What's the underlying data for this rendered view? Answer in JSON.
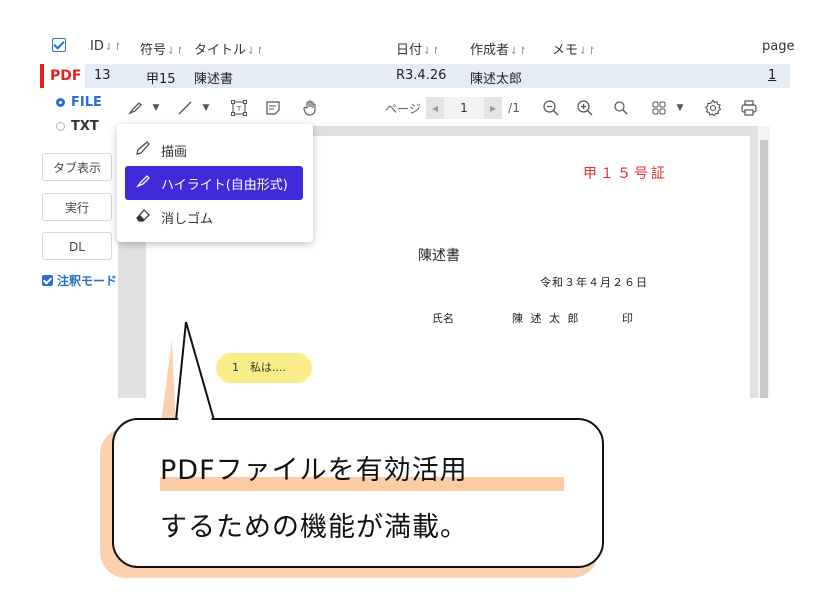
{
  "table": {
    "columns": [
      {
        "label": "ID"
      },
      {
        "label": "符号"
      },
      {
        "label": "タイトル"
      },
      {
        "label": "日付"
      },
      {
        "label": "作成者"
      },
      {
        "label": "メモ"
      },
      {
        "label": "page"
      }
    ],
    "sort_glyph": "⇃↾",
    "row": {
      "badge": "PDF",
      "id": "13",
      "code": "甲15",
      "title": "陳述書",
      "date": "R3.4.26",
      "author": "陳述太郎",
      "page": "1"
    }
  },
  "left_panel": {
    "radio_file": "FILE",
    "radio_txt": "TXT",
    "btn_tab": "タブ表示",
    "btn_run": "実行",
    "btn_dl": "DL",
    "annotation_mode": "注釈モード"
  },
  "toolbar": {
    "page_label": "ページ",
    "page_number": "1",
    "page_total": "/1",
    "icons": [
      "highlighter-icon",
      "line-icon",
      "text-box-icon",
      "note-icon",
      "hand-icon",
      "zoom-out-icon",
      "zoom-in-icon",
      "search-icon",
      "grid-icon",
      "settings-icon",
      "print-icon"
    ]
  },
  "menu": {
    "items": [
      {
        "label": "描画",
        "icon": "pen-icon"
      },
      {
        "label": "ハイライト(自由形式)",
        "icon": "highlighter-icon"
      },
      {
        "label": "消しゴム",
        "icon": "eraser-icon"
      }
    ],
    "active_index": 1
  },
  "document": {
    "exhibit_label": "甲１５号証",
    "title": "陳述書",
    "date": "令和３年４月２６日",
    "name_label": "氏名",
    "name_value": "陳 述 太 郎",
    "seal": "印",
    "highlight_text": "1　私は...."
  },
  "callout": {
    "line1": "PDFファイルを有効活用",
    "line2": "するための機能が満載。"
  },
  "colors": {
    "accent": "#2a6ed0",
    "pdf_badge": "#e02222",
    "menu_active": "#3f2ad9",
    "exhibit": "#e53030",
    "highlight": "#fbee8a",
    "callout_accent": "#fbd0ae"
  }
}
